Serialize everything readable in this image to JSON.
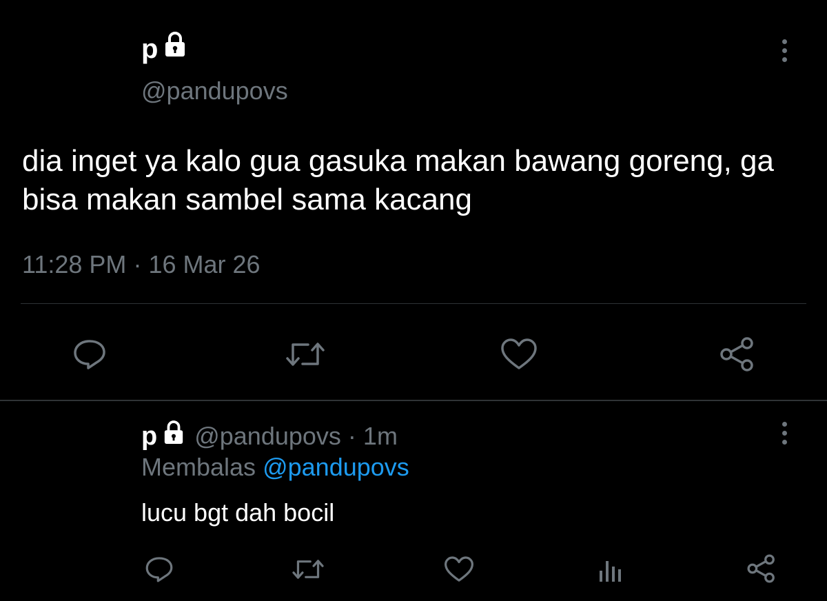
{
  "main_tweet": {
    "display_name": "p",
    "handle": "@pandupovs",
    "text": "dia inget ya kalo gua gasuka makan bawang goreng, ga bisa makan sambel sama kacang",
    "time": "11:28 PM",
    "separator": "·",
    "date": "16 Mar 26",
    "actions": [
      "reply-icon",
      "retweet-icon",
      "like-icon",
      "share-icon"
    ]
  },
  "reply_tweet": {
    "display_name": "p",
    "handle": "@pandupovs",
    "separator": "·",
    "age": "1m",
    "replying_label": "Membalas",
    "replying_to": "@pandupovs",
    "text": "lucu bgt dah bocil",
    "actions": [
      "reply-icon",
      "retweet-icon",
      "like-icon",
      "analytics-icon",
      "share-icon"
    ]
  },
  "colors": {
    "background": "#000000",
    "text": "#ffffff",
    "muted": "#6e767d",
    "link": "#1d9bf0",
    "divider": "#2f3336"
  }
}
